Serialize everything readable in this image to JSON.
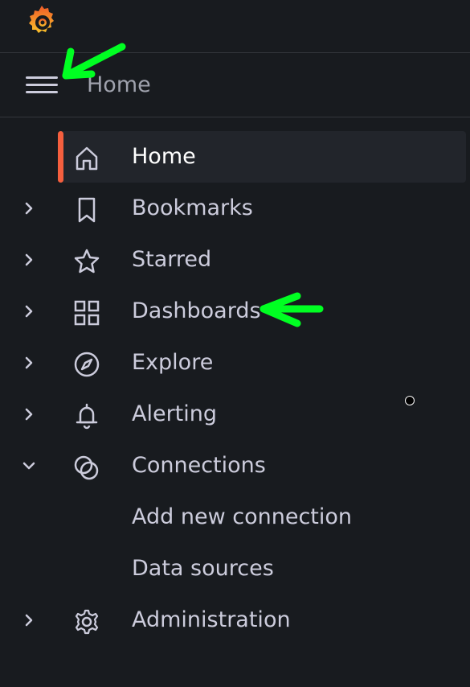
{
  "header": {
    "breadcrumb": "Home"
  },
  "nav": {
    "items": [
      {
        "label": "Home",
        "icon": "home-icon",
        "active": true,
        "expandable": false
      },
      {
        "label": "Bookmarks",
        "icon": "bookmark-icon",
        "expandable": true,
        "expanded": false
      },
      {
        "label": "Starred",
        "icon": "star-icon",
        "expandable": true,
        "expanded": false
      },
      {
        "label": "Dashboards",
        "icon": "apps-icon",
        "expandable": true,
        "expanded": false
      },
      {
        "label": "Explore",
        "icon": "compass-icon",
        "expandable": true,
        "expanded": false
      },
      {
        "label": "Alerting",
        "icon": "bell-icon",
        "expandable": true,
        "expanded": false
      },
      {
        "label": "Connections",
        "icon": "link-circles-icon",
        "expandable": true,
        "expanded": true
      },
      {
        "label": "Add new connection",
        "sub": true
      },
      {
        "label": "Data sources",
        "sub": true
      },
      {
        "label": "Administration",
        "icon": "cog-icon",
        "expandable": true,
        "expanded": false
      }
    ]
  },
  "colors": {
    "background": "#181b1f",
    "active_bg": "#22252b",
    "accent": "#f55f3e",
    "annotation": "#00ff22",
    "text": "#ccccdc"
  }
}
